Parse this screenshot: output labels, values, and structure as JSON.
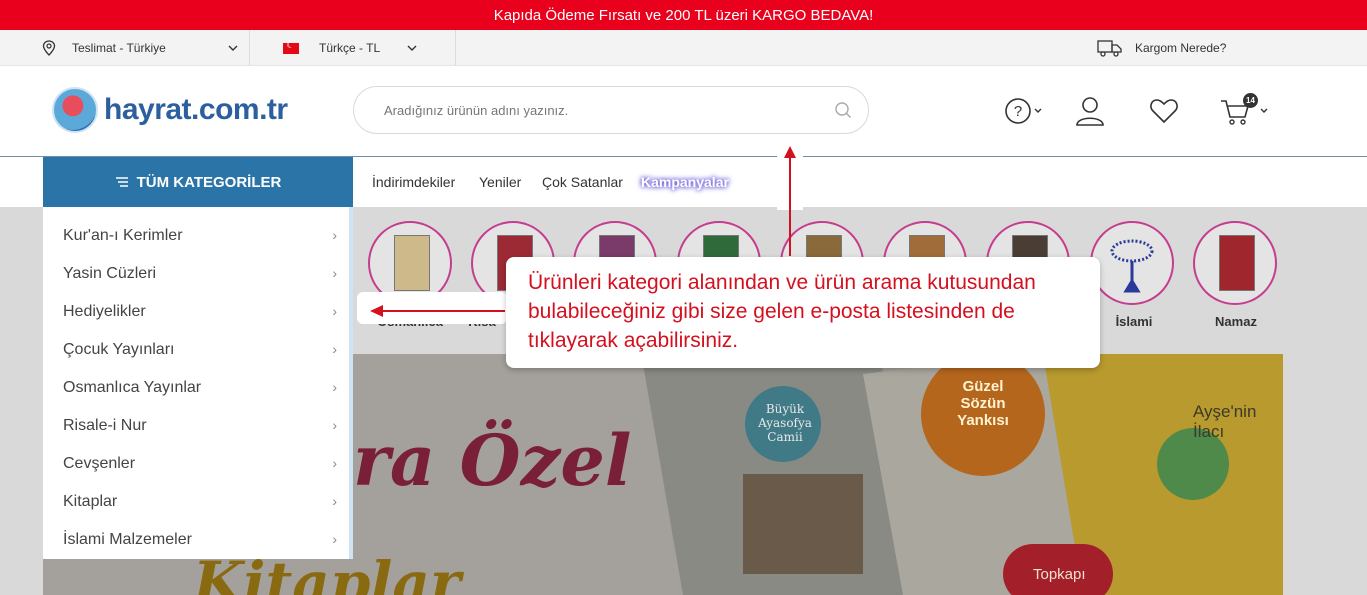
{
  "promo_bar": {
    "text": "Kapıda Ödeme Fırsatı ve 200 TL üzeri KARGO BEDAVA!"
  },
  "topbar": {
    "delivery": "Teslimat - Türkiye",
    "language": "Türkçe - TL",
    "cargo": "Kargom Nerede?"
  },
  "header": {
    "logo_text": "hayrat.com.tr",
    "search_placeholder": "Aradığınız ürünün adını yazınız.",
    "cart_count": "14"
  },
  "navbar": {
    "all_categories": "TÜM KATEGORİLER",
    "links": [
      "İndirimdekiler",
      "Yeniler",
      "Çok Satanlar",
      "Kampanyalar"
    ]
  },
  "categories": [
    "Kur'an-ı Kerimler",
    "Yasin Cüzleri",
    "Hediyelikler",
    "Çocuk Yayınları",
    "Osmanlıca Yayınlar",
    "Risale-i Nur",
    "Cevşenler",
    "Kitaplar",
    "İslami Malzemeler"
  ],
  "circle_labels": {
    "c1": "Osmanlıca",
    "c2": "Kısa",
    "c9": "İslami",
    "c10": "Namaz"
  },
  "banner": {
    "text_main": "ra Özel",
    "text_sub": "Kitaplar",
    "book1": "Büyük Ayasofya Camii",
    "book2": "Güzel Sözün Yankısı",
    "book3": "Ayşe'nin İlacı",
    "book4": "Topkapı"
  },
  "callout": {
    "text": "Ürünleri kategori alanından ve ürün arama kutusundan bulabileceğiniz gibi size gelen e-posta listesinden de tıklayarak açabilirsiniz."
  },
  "colors": {
    "promo": "#e8001c",
    "nav_blue": "#2a74a8",
    "callout_text": "#d4101f",
    "circle_border": "#c53d8e"
  }
}
